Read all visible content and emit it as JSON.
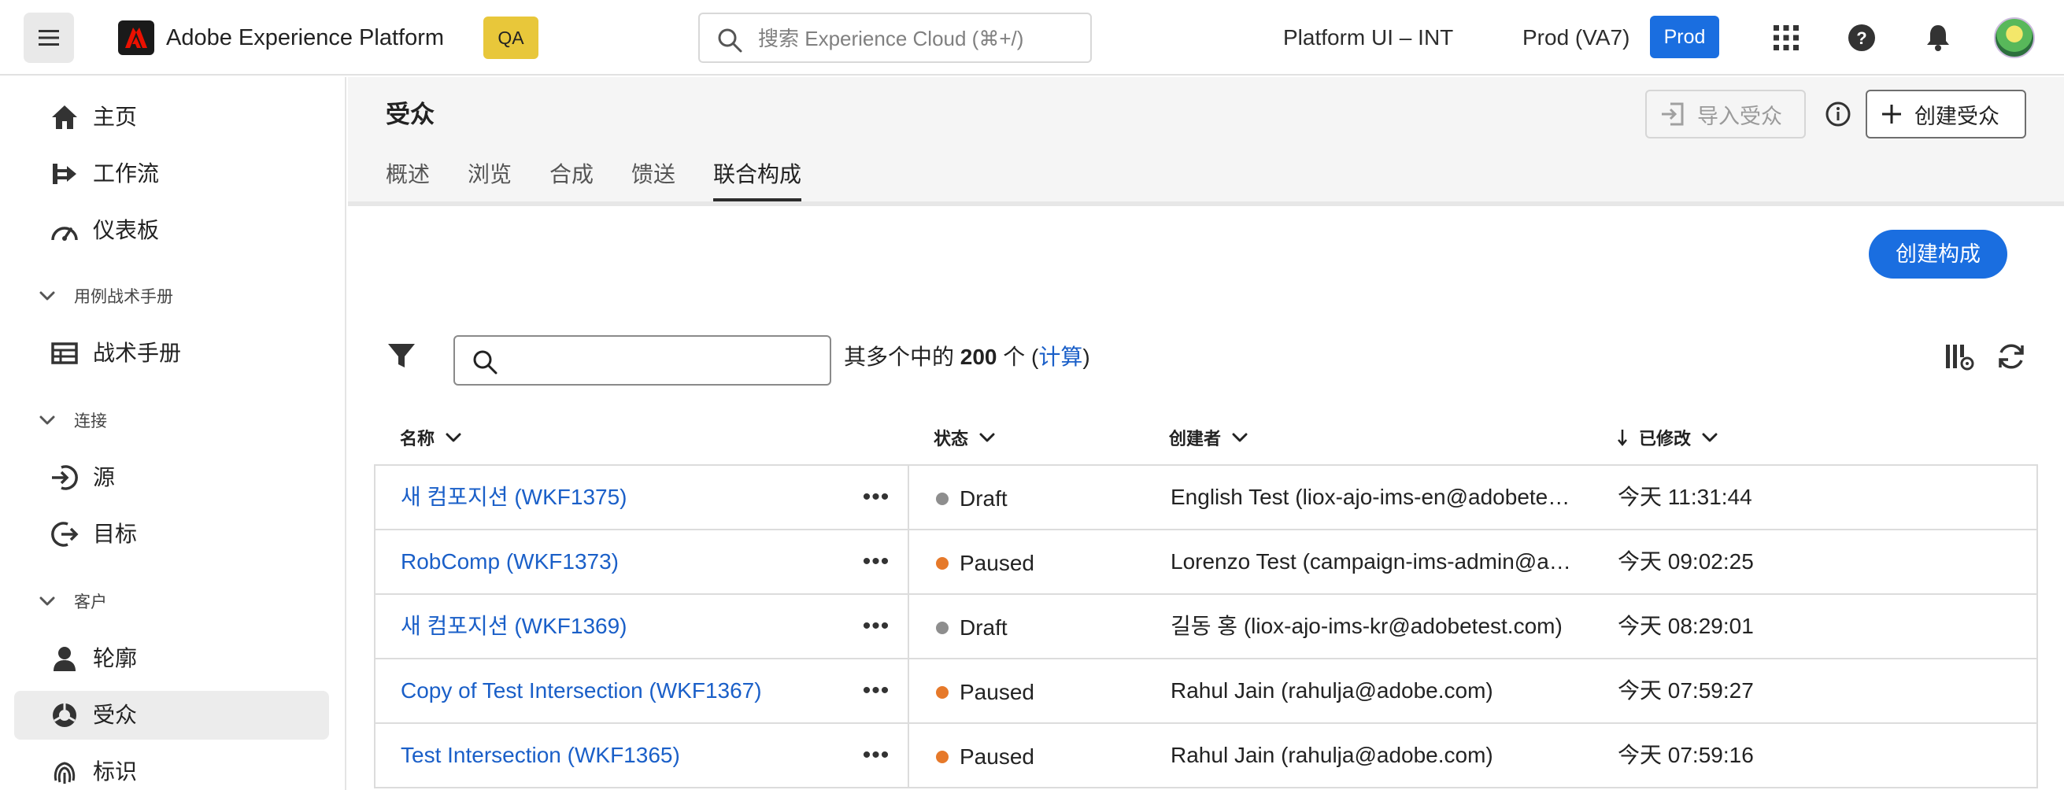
{
  "topbar": {
    "app_name": "Adobe Experience Platform",
    "env_badge": "QA",
    "search_placeholder": "搜索 Experience Cloud (⌘+/)",
    "org_name": "Platform UI – INT",
    "sandbox_name": "Prod (VA7)",
    "sandbox_badge": "Prod"
  },
  "sidebar": {
    "items": [
      {
        "label": "主页",
        "icon": "home-icon"
      },
      {
        "label": "工作流",
        "icon": "workflow-icon"
      },
      {
        "label": "仪表板",
        "icon": "dashboard-icon"
      },
      {
        "label": "战术手册",
        "icon": "playbook-icon"
      },
      {
        "label": "源",
        "icon": "source-icon"
      },
      {
        "label": "目标",
        "icon": "destination-icon"
      },
      {
        "label": "轮廓",
        "icon": "profile-icon"
      },
      {
        "label": "受众",
        "icon": "audience-icon"
      },
      {
        "label": "标识",
        "icon": "identity-icon"
      }
    ],
    "sections": [
      {
        "label": "用例战术手册"
      },
      {
        "label": "连接"
      },
      {
        "label": "客户"
      }
    ]
  },
  "page": {
    "title": "受众",
    "import_button": "导入受众",
    "create_audience_button": "创建受众",
    "tabs": [
      {
        "label": "概述"
      },
      {
        "label": "浏览"
      },
      {
        "label": "合成"
      },
      {
        "label": "馈送"
      },
      {
        "label": "联合构成"
      }
    ],
    "active_tab": "联合构成",
    "create_composition_button": "创建构成"
  },
  "toolbar": {
    "count_prefix": "其多个中的 ",
    "count_value": "200",
    "count_suffix": " 个 (",
    "count_link": "计算",
    "count_close": ")"
  },
  "table": {
    "headers": {
      "name": "名称",
      "status": "状态",
      "creator": "创建者",
      "modified": "已修改"
    },
    "rows": [
      {
        "name": "새 컴포지션 (WKF1375)",
        "status": "Draft",
        "status_color": "#8e8e8e",
        "creator": "English Test (liox-ajo-ims-en@adobetest.com)",
        "modified": "今天 11:31:44"
      },
      {
        "name": "RobComp (WKF1373)",
        "status": "Paused",
        "status_color": "#e6792a",
        "creator": "Lorenzo Test (campaign-ims-admin@adobetest.com)",
        "modified": "今天 09:02:25"
      },
      {
        "name": "새 컴포지션 (WKF1369)",
        "status": "Draft",
        "status_color": "#8e8e8e",
        "creator": "길동 홍 (liox-ajo-ims-kr@adobetest.com)",
        "modified": "今天 08:29:01"
      },
      {
        "name": "Copy of Test Intersection (WKF1367)",
        "status": "Paused",
        "status_color": "#e6792a",
        "creator": "Rahul Jain (rahulja@adobe.com)",
        "modified": "今天 07:59:27"
      },
      {
        "name": "Test Intersection (WKF1365)",
        "status": "Paused",
        "status_color": "#e6792a",
        "creator": "Rahul Jain (rahulja@adobe.com)",
        "modified": "今天 07:59:16"
      }
    ]
  }
}
